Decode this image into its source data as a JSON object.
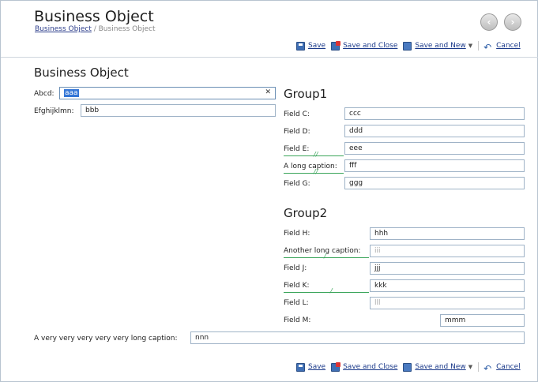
{
  "header": {
    "title": "Business Object",
    "breadcrumb_link": "Business Object",
    "breadcrumb_sep": " / ",
    "breadcrumb_current": "Business Object"
  },
  "toolbar": {
    "save": "Save",
    "save_close": "Save and Close",
    "save_new": "Save and New",
    "cancel": "Cancel"
  },
  "section_title": "Business Object",
  "left_fields": [
    {
      "label": "Abcd:",
      "value": "aaa"
    },
    {
      "label": "Efghijklmn:",
      "value": "bbb"
    }
  ],
  "group1": {
    "title": "Group1",
    "fields": [
      {
        "label": "Field C:",
        "value": "ccc"
      },
      {
        "label": "Field D:",
        "value": "ddd"
      },
      {
        "label": "Field E:",
        "value": "eee"
      },
      {
        "label": "A long caption:",
        "value": "fff"
      },
      {
        "label": "Field G:",
        "value": "ggg"
      }
    ]
  },
  "group2": {
    "title": "Group2",
    "fields": [
      {
        "label": "Field H:",
        "value": "hhh"
      },
      {
        "label": "Another long caption:",
        "value": "iii"
      },
      {
        "label": "Field J:",
        "value": "jjj"
      },
      {
        "label": "Field K:",
        "value": "kkk"
      },
      {
        "label": "Field L:",
        "value": "lll"
      },
      {
        "label": "Field M:",
        "value": "mmm"
      }
    ]
  },
  "bottom_field": {
    "label": "A very very very very very long caption:",
    "value": "nnn"
  },
  "icons": [
    "back-icon",
    "forward-icon",
    "save-icon",
    "save-close-icon",
    "save-new-icon",
    "cancel-icon",
    "clear-icon",
    "dropdown-caret-icon"
  ],
  "colors": {
    "link": "#1b3a8a",
    "selection": "#3375d6",
    "guide": "#3aa55a"
  }
}
